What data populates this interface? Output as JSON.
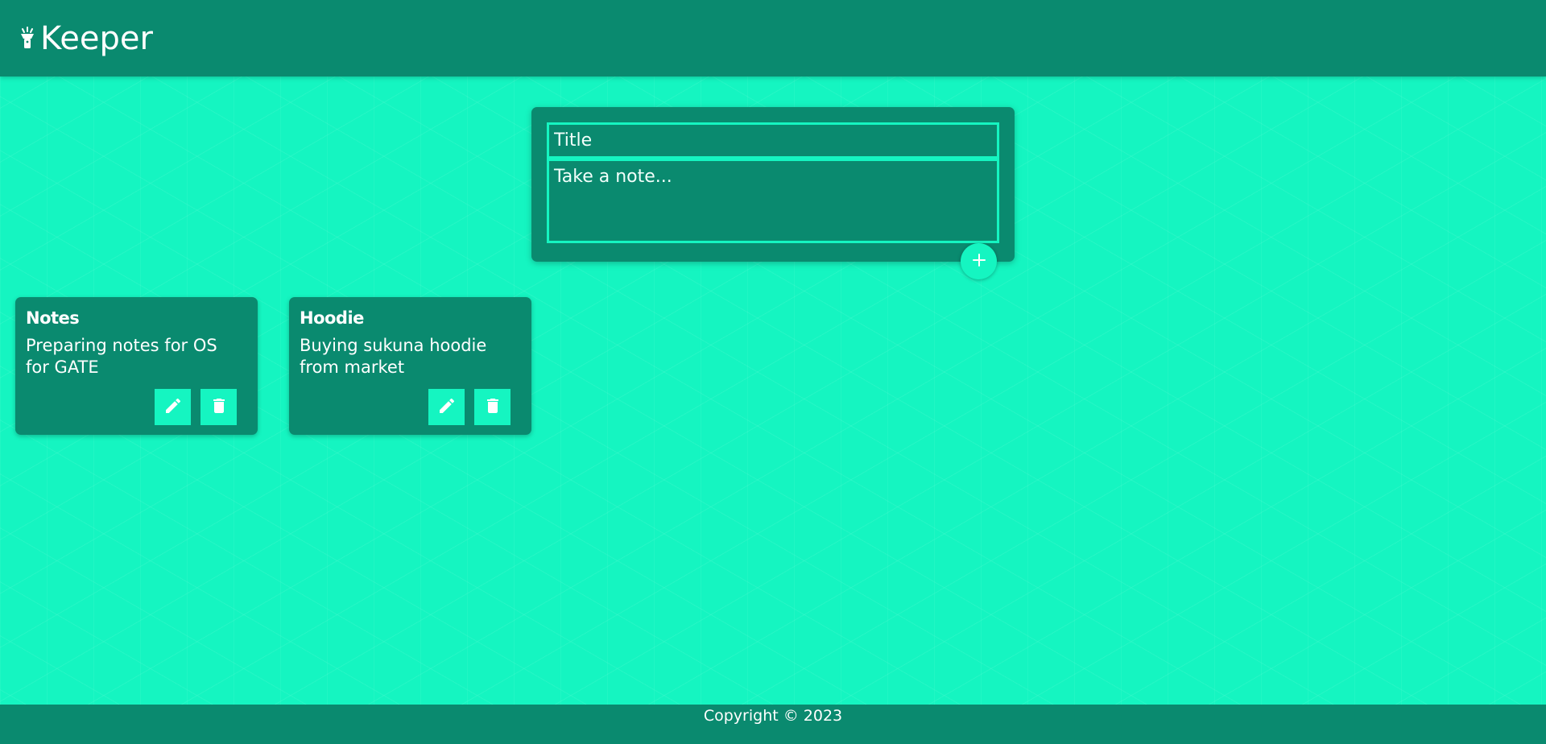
{
  "app": {
    "title": "Keeper",
    "logo_icon": "flashlight-icon"
  },
  "create_area": {
    "title_placeholder": "Title",
    "title_value": "",
    "content_placeholder": "Take a note...",
    "content_value": "",
    "add_button_icon": "plus-icon"
  },
  "notes": [
    {
      "title": "Notes",
      "content": "Preparing notes for OS for GATE",
      "edit_icon": "pencil-icon",
      "delete_icon": "trash-icon"
    },
    {
      "title": "Hoodie",
      "content": "Buying sukuna hoodie from market",
      "edit_icon": "pencil-icon",
      "delete_icon": "trash-icon"
    }
  ],
  "footer": {
    "text": "Copyright © 2023"
  },
  "colors": {
    "background": "#15f5c1",
    "primary": "#0a8a6f",
    "accent": "#15f5c1",
    "text": "#ffffff"
  }
}
